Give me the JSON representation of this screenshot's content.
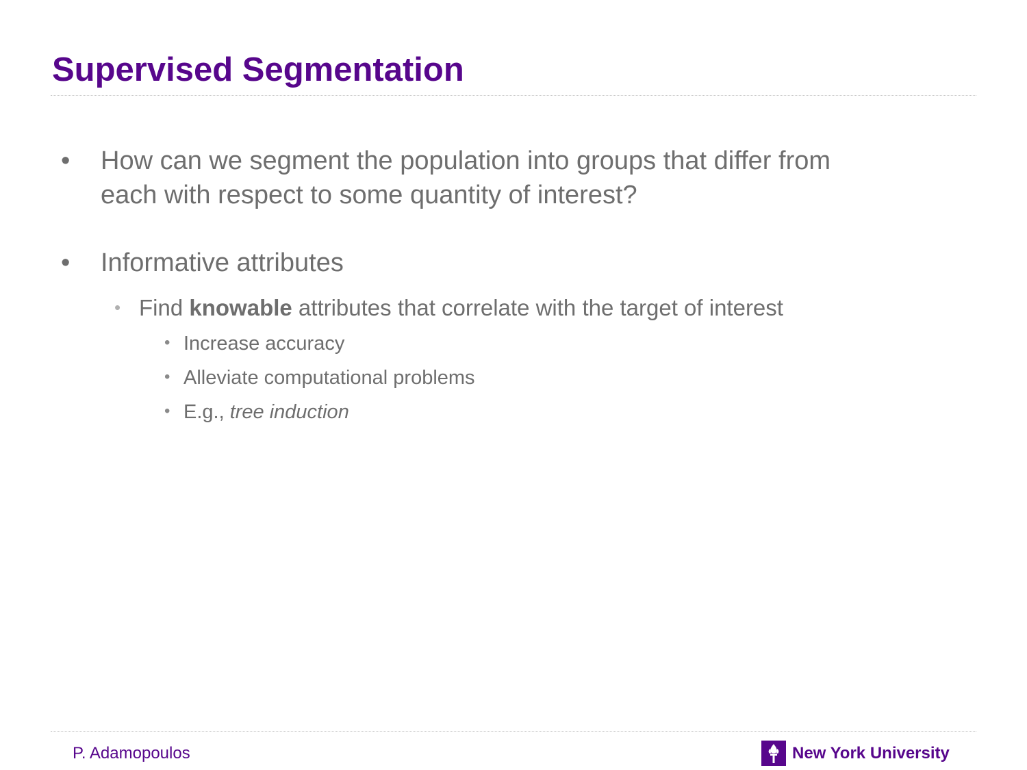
{
  "slide": {
    "title": "Supervised Segmentation"
  },
  "bullets": {
    "b1_line1": "How can we segment the population into groups that differ from",
    "b1_line2": "each with respect to some quantity of interest?",
    "b2": "Informative attributes",
    "b2_1_before": "Find ",
    "b2_1_bold": "knowable",
    "b2_1_after": " attributes that correlate with the target of interest",
    "b2_1_1": "Increase accuracy",
    "b2_1_2": "Alleviate computational problems",
    "b2_1_3_prefix": "E.g., ",
    "b2_1_3_italic": "tree induction",
    "mark_l1": "•",
    "mark_l2": "•",
    "mark_l3": "•"
  },
  "footer": {
    "author": "P. Adamopoulos",
    "organization": "New York University",
    "logo_icon": "nyu-torch-icon"
  },
  "colors": {
    "title": "#57068c",
    "body_text": "#6e6e6e",
    "brand": "#57068c"
  }
}
